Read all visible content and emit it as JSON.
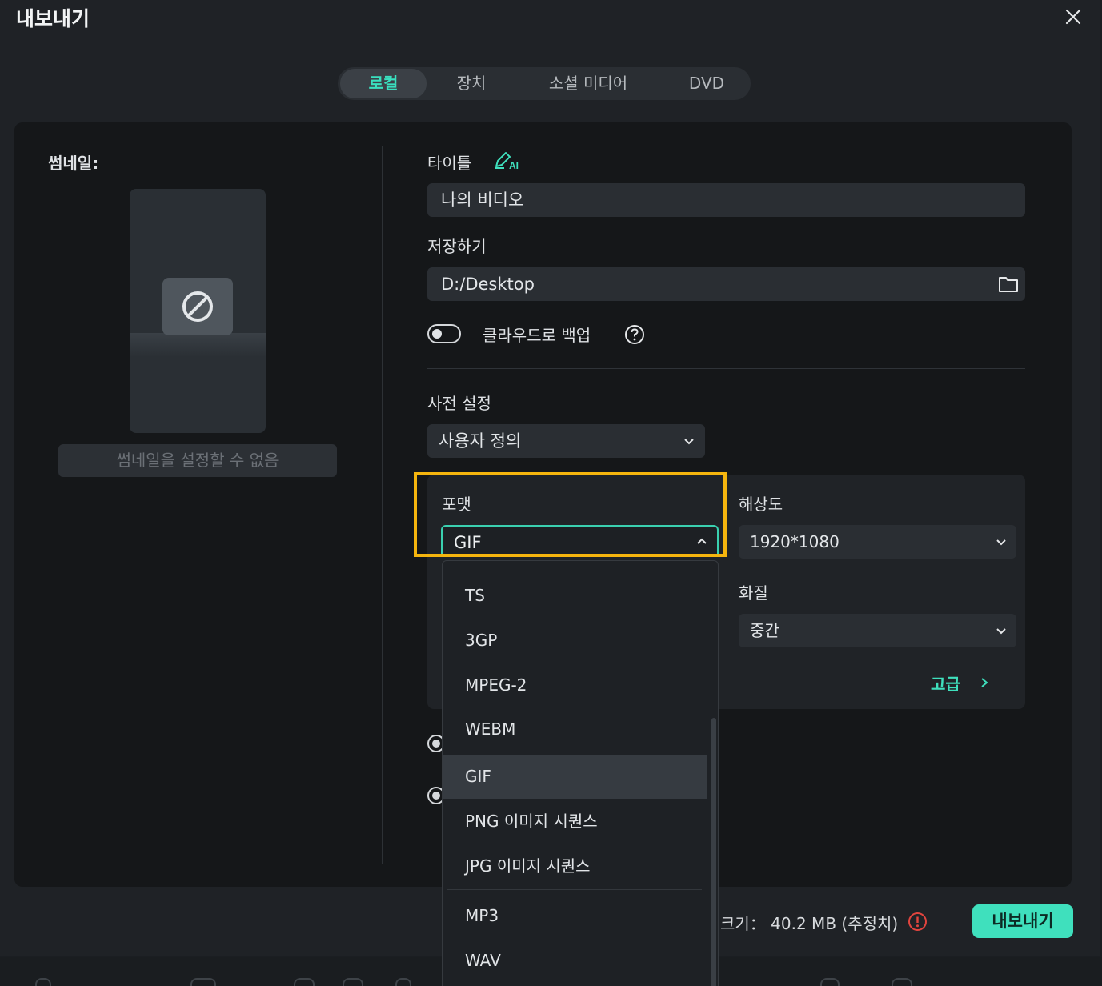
{
  "dialog": {
    "title": "내보내기"
  },
  "tabs": [
    {
      "label": "로컬",
      "active": true
    },
    {
      "label": "장치",
      "active": false
    },
    {
      "label": "소셜 미디어",
      "active": false
    },
    {
      "label": "DVD",
      "active": false
    }
  ],
  "thumbnail": {
    "label": "썸네일:",
    "button_label": "썸네일을 설정할 수 없음"
  },
  "title_field": {
    "label": "타이틀",
    "ai_badge": "AI",
    "value": "나의 비디오"
  },
  "save_field": {
    "label": "저장하기",
    "value": "D:/Desktop"
  },
  "cloud_backup": {
    "label": "클라우드로 백업",
    "enabled": false
  },
  "preset": {
    "label": "사전 설정",
    "value": "사용자 정의"
  },
  "format": {
    "label": "포맷",
    "value": "GIF",
    "options": [
      "TS",
      "3GP",
      "MPEG-2",
      "WEBM",
      "GIF",
      "PNG 이미지 시퀀스",
      "JPG 이미지 시퀀스",
      "MP3",
      "WAV"
    ],
    "selected": "GIF"
  },
  "resolution": {
    "label": "해상도",
    "value": "1920*1080"
  },
  "quality": {
    "label": "화질",
    "value": "중간"
  },
  "advanced": {
    "label": "고급"
  },
  "footer": {
    "size_label": "크기：",
    "size_value": "40.2 MB (추정치)",
    "export_button": "내보내기"
  },
  "colors": {
    "accent": "#3fe0bd",
    "highlight": "#f5b50e",
    "warning": "#e0443e"
  }
}
